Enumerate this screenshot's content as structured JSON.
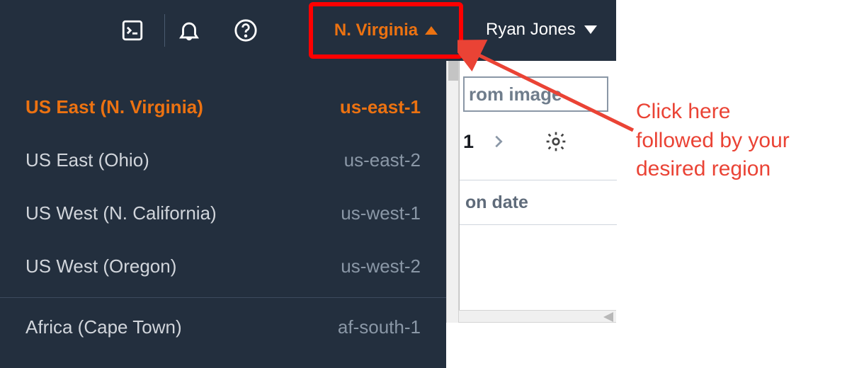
{
  "header": {
    "region_label": "N. Virginia",
    "user_label": "Ryan Jones"
  },
  "region_dropdown": {
    "items": [
      {
        "name": "US East (N. Virginia)",
        "id": "us-east-1",
        "selected": true
      },
      {
        "name": "US East (Ohio)",
        "id": "us-east-2",
        "selected": false
      },
      {
        "name": "US West (N. California)",
        "id": "us-west-1",
        "selected": false
      },
      {
        "name": "US West (Oregon)",
        "id": "us-west-2",
        "selected": false
      },
      {
        "separator": true
      },
      {
        "name": "Africa (Cape Town)",
        "id": "af-south-1",
        "selected": false
      }
    ]
  },
  "content": {
    "button_fragment": "rom image",
    "page_number": "1",
    "column_fragment": "on date"
  },
  "annotation": {
    "line1": "Click here",
    "line2": "followed by your",
    "line3": "desired region"
  }
}
